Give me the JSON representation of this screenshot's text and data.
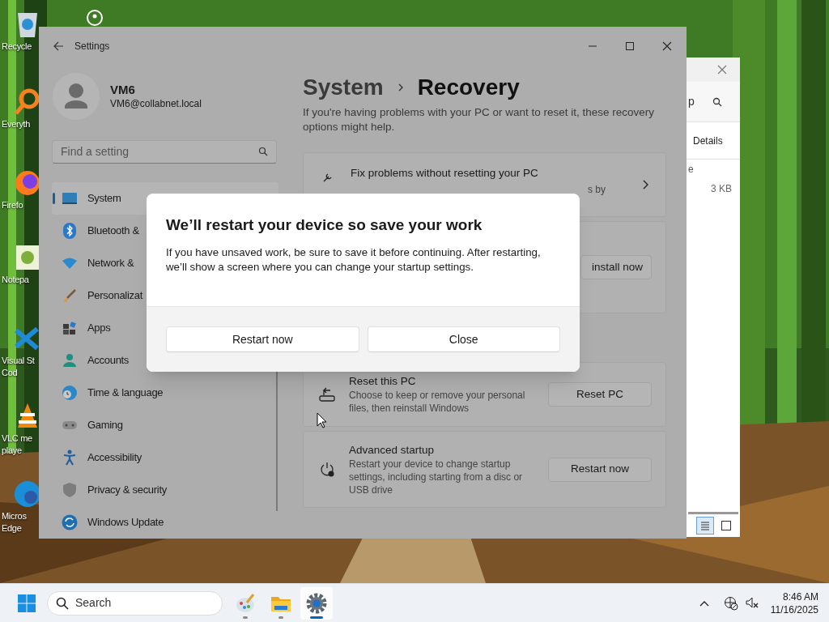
{
  "desktop": {
    "icons": [
      {
        "lines": [
          "Recycle"
        ]
      },
      {
        "lines": [
          "Everyth"
        ]
      },
      {
        "lines": [
          "Firefo"
        ]
      },
      {
        "lines": [
          "Notepa"
        ]
      },
      {
        "lines": [
          "Visual St",
          "Cod"
        ]
      },
      {
        "lines": [
          "VLC me",
          "playe"
        ]
      },
      {
        "lines": [
          "Micros",
          "Edge"
        ]
      }
    ]
  },
  "explorer_window": {
    "toolbar_fragment": "p",
    "view_label": "Details",
    "column_fragment": "e",
    "file_size": "3 KB",
    "view_buttons": [
      {
        "kind": "list",
        "selected": true
      },
      {
        "kind": "tiles",
        "selected": false
      }
    ]
  },
  "settings_window": {
    "title": "Settings",
    "account": {
      "name": "VM6",
      "email": "VM6@collabnet.local"
    },
    "search": {
      "placeholder": "Find a setting"
    },
    "nav": [
      {
        "label": "System",
        "selected": true
      },
      {
        "label": "Bluetooth &",
        "selected": false
      },
      {
        "label": "Network &",
        "selected": false
      },
      {
        "label": "Personalizat",
        "selected": false
      },
      {
        "label": "Apps",
        "selected": false
      },
      {
        "label": "Accounts",
        "selected": false
      },
      {
        "label": "Time & language",
        "selected": false
      },
      {
        "label": "Gaming",
        "selected": false
      },
      {
        "label": "Accessibility",
        "selected": false
      },
      {
        "label": "Privacy & security",
        "selected": false
      },
      {
        "label": "Windows Update",
        "selected": false
      }
    ],
    "breadcrumb": {
      "parent": "System",
      "current": "Recovery"
    },
    "description": "If you're having problems with your PC or want to reset it, these recovery options might help.",
    "cards": [
      {
        "kind": "link",
        "title": "Fix problems without resetting your PC",
        "fragment": "s by"
      },
      {
        "kind": "partial",
        "button": "install now"
      },
      {
        "kind": "action",
        "title": "Reset this PC",
        "text": "Choose to keep or remove your personal files, then reinstall Windows",
        "button": "Reset PC"
      },
      {
        "kind": "action",
        "title": "Advanced startup",
        "text": "Restart your device to change startup settings, including starting from a disc or USB drive",
        "button": "Restart now"
      }
    ]
  },
  "dialog": {
    "title": "We’ll restart your device so save your work",
    "body": "If you have unsaved work, be sure to save it before continuing. After restarting, we’ll show a screen where you can change your startup settings.",
    "buttons": [
      "Restart now",
      "Close"
    ]
  },
  "taskbar": {
    "search_placeholder": "Search",
    "apps": [
      {
        "kind": "paint",
        "active": false
      },
      {
        "kind": "folder",
        "active": false
      },
      {
        "kind": "settings",
        "active": true
      }
    ],
    "time": "8:46 AM",
    "date": "11/16/2025"
  }
}
